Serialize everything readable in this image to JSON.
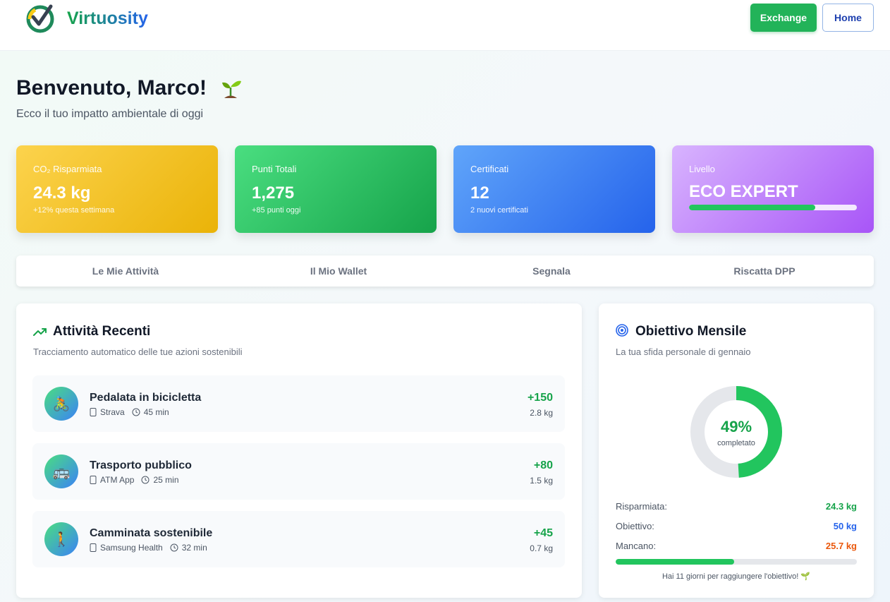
{
  "header": {
    "brand": "Virtuosity",
    "exchange_label": "Exchange",
    "home_label": "Home"
  },
  "welcome": {
    "title": "Benvenuto, Marco!",
    "subtitle": "Ecco il tuo impatto ambientale di oggi"
  },
  "stats": [
    {
      "label": "CO₂ Risparmiata",
      "value": "24.3 kg",
      "sub": "+12% questa settimana"
    },
    {
      "label": "Punti Totali",
      "value": "1,275",
      "sub": "+85 punti oggi"
    },
    {
      "label": "Certificati",
      "value": "12",
      "sub": "2 nuovi certificati"
    },
    {
      "label": "Livello",
      "value": "ECO EXPERT",
      "progress": 0.75
    }
  ],
  "tabs": [
    {
      "label": "Le Mie Attività",
      "active": true
    },
    {
      "label": "Il Mio Wallet",
      "active": false
    },
    {
      "label": "Segnala",
      "active": false
    },
    {
      "label": "Riscatta DPP",
      "active": false
    }
  ],
  "recent": {
    "title": "Attività Recenti",
    "subtitle": "Tracciamento automatico delle tue azioni sostenibili",
    "items": [
      {
        "name": "Pedalata in bicicletta",
        "source": "Strava",
        "duration": "45 min",
        "points": "+150",
        "co2": "2.8 kg",
        "icon": "bicycle-icon",
        "emoji": "🚴"
      },
      {
        "name": "Trasporto pubblico",
        "source": "ATM App",
        "duration": "25 min",
        "points": "+80",
        "co2": "1.5 kg",
        "icon": "bus-icon",
        "emoji": "🚌"
      },
      {
        "name": "Camminata sostenibile",
        "source": "Samsung Health",
        "duration": "32 min",
        "points": "+45",
        "co2": "0.7 kg",
        "icon": "walking-icon",
        "emoji": "🚶"
      }
    ]
  },
  "goal": {
    "title": "Obiettivo Mensile",
    "subtitle": "La tua sfida personale di gennaio",
    "percent": 49,
    "percent_text": "49%",
    "completed_label": "completato",
    "rows": [
      {
        "label": "Risparmiata:",
        "value": "24.3 kg",
        "color": "#16a34a"
      },
      {
        "label": "Obiettivo:",
        "value": "50 kg",
        "color": "#2563eb"
      },
      {
        "label": "Mancano:",
        "value": "25.7 kg",
        "color": "#ea580c"
      }
    ],
    "note": "Hai 11 giorni per raggiungere l'obiettivo! 🌱"
  },
  "colors": {
    "accent_green": "#22c55e",
    "accent_blue": "#2563eb"
  }
}
